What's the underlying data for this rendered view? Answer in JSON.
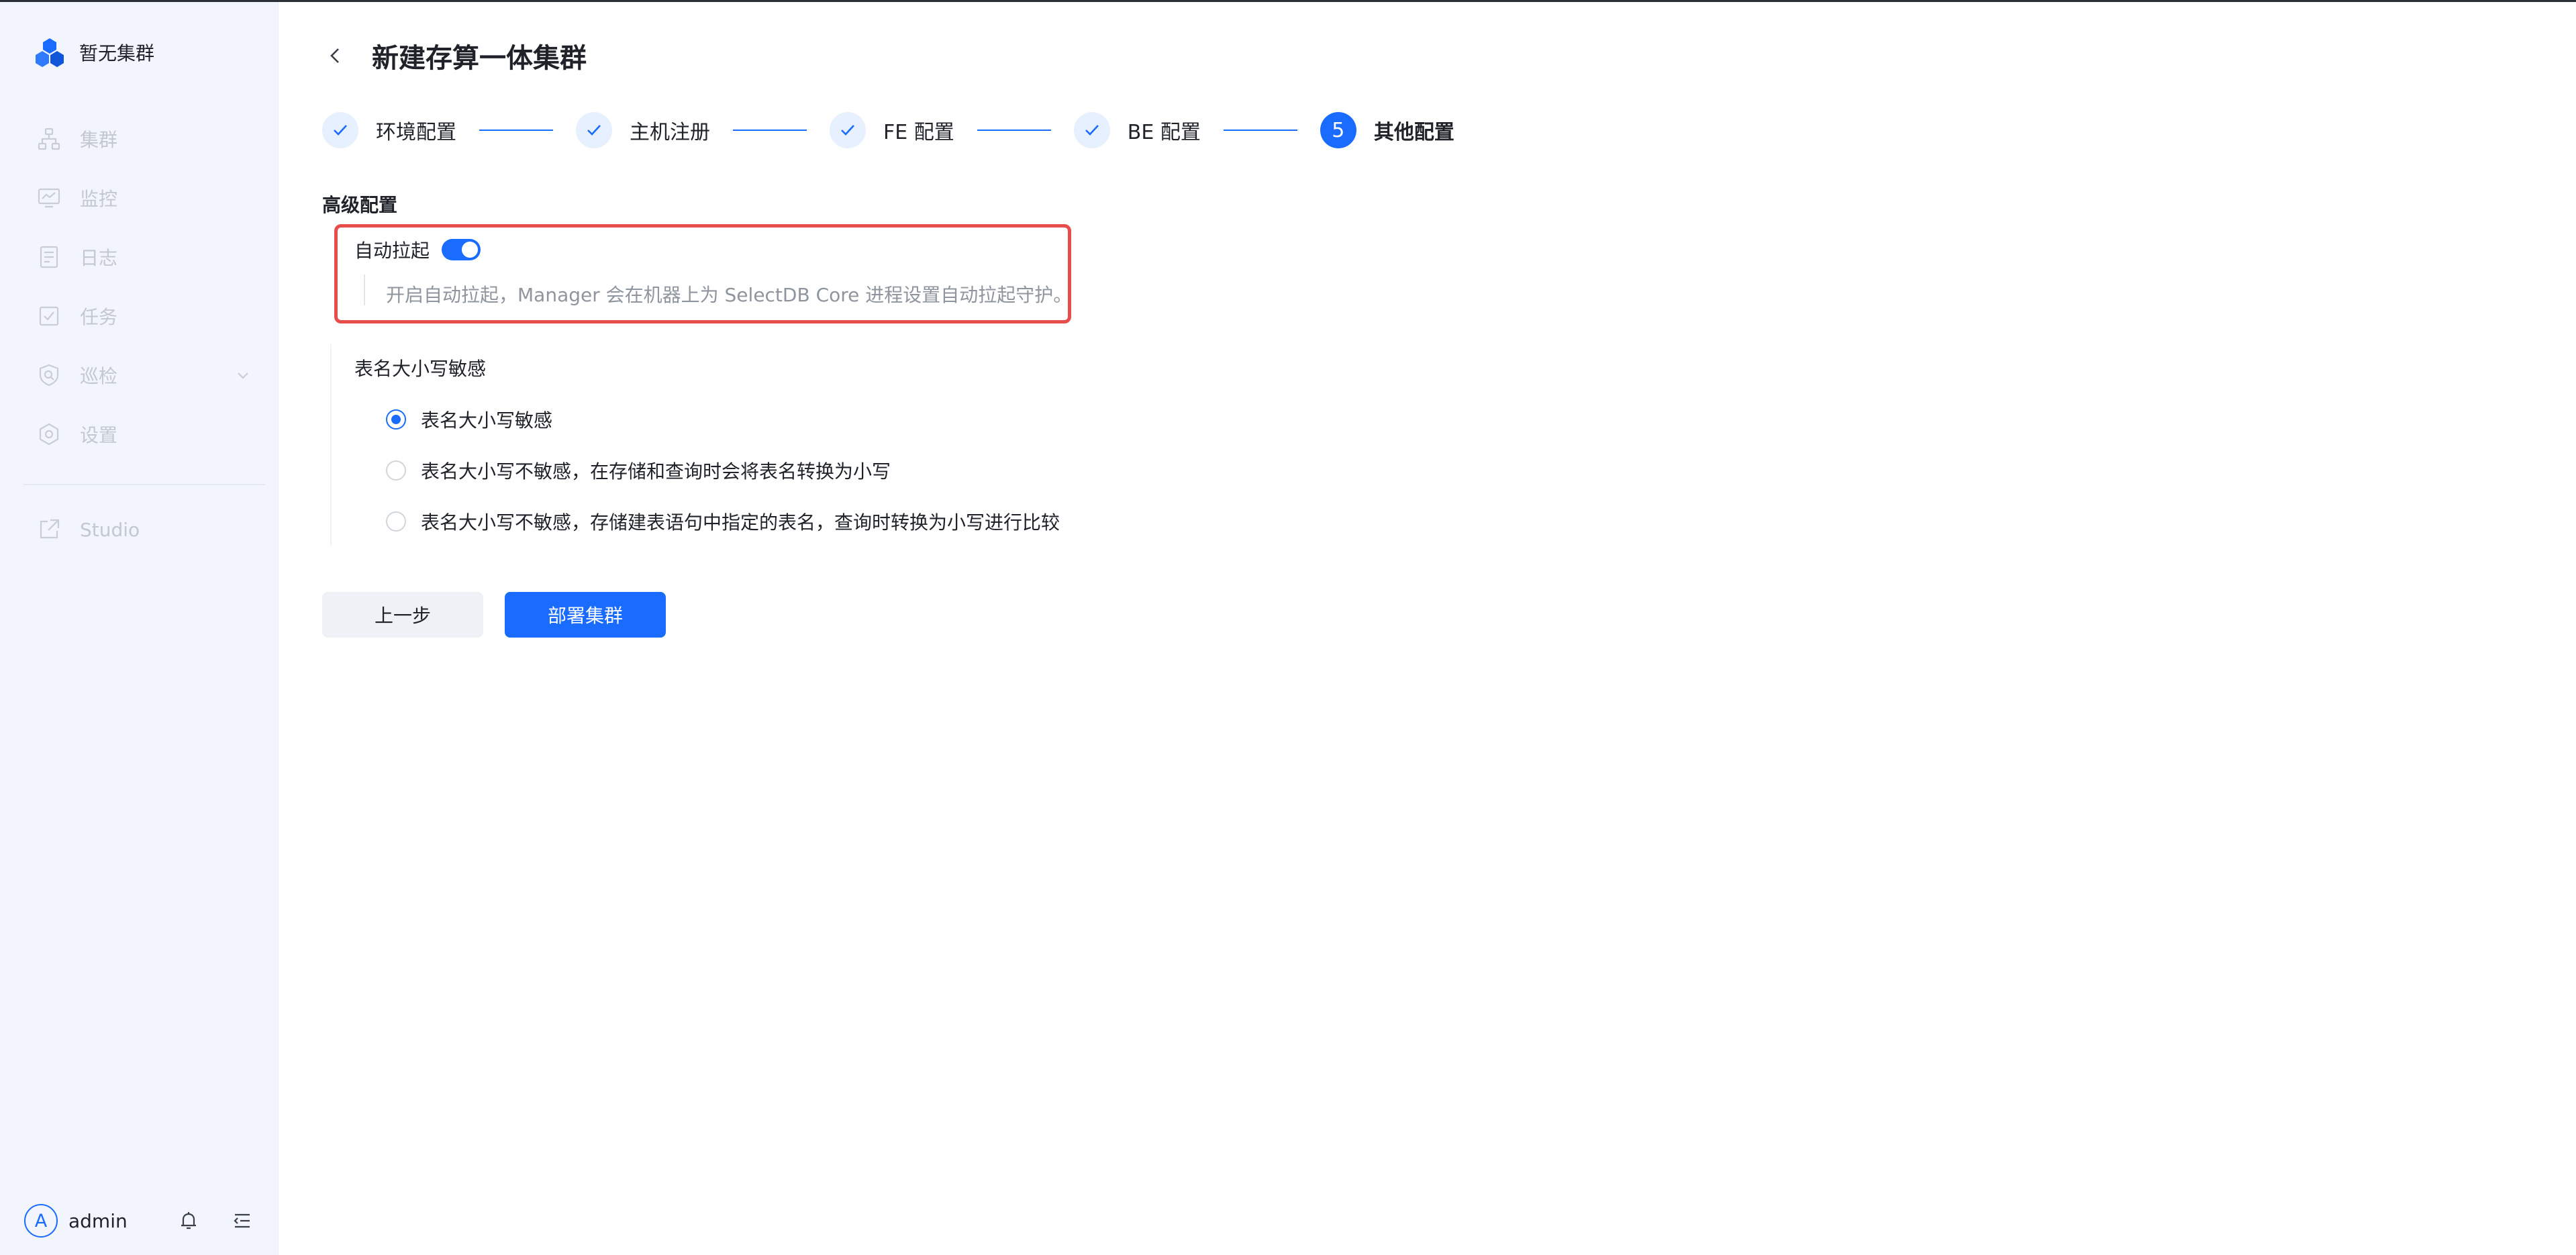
{
  "sidebar": {
    "brand_label": "暂无集群",
    "items": [
      {
        "label": "集群",
        "icon": "cluster-icon"
      },
      {
        "label": "监控",
        "icon": "monitor-icon"
      },
      {
        "label": "日志",
        "icon": "log-icon"
      },
      {
        "label": "任务",
        "icon": "task-icon"
      },
      {
        "label": "巡检",
        "icon": "inspection-icon"
      },
      {
        "label": "设置",
        "icon": "settings-icon"
      }
    ],
    "studio_label": "Studio",
    "user": {
      "avatar_letter": "A",
      "name": "admin"
    }
  },
  "header": {
    "title": "新建存算一体集群"
  },
  "steps": [
    {
      "label": "环境配置",
      "status": "done"
    },
    {
      "label": "主机注册",
      "status": "done"
    },
    {
      "label": "FE 配置",
      "status": "done"
    },
    {
      "label": "BE 配置",
      "status": "done"
    },
    {
      "label": "其他配置",
      "status": "active",
      "number": "5"
    }
  ],
  "advanced": {
    "title": "高级配置",
    "auto_restart": {
      "label": "自动拉起",
      "enabled": true,
      "help": "开启自动拉起，Manager 会在机器上为 SelectDB Core 进程设置自动拉起守护。"
    },
    "case_sensitivity": {
      "label": "表名大小写敏感",
      "options": [
        {
          "label": "表名大小写敏感",
          "checked": true
        },
        {
          "label": "表名大小写不敏感，在存储和查询时会将表名转换为小写",
          "checked": false
        },
        {
          "label": "表名大小写不敏感，存储建表语句中指定的表名，查询时转换为小写进行比较",
          "checked": false
        }
      ]
    }
  },
  "actions": {
    "prev_label": "上一步",
    "deploy_label": "部署集群"
  },
  "colors": {
    "primary": "#1a6bff",
    "highlight": "#e84c4c",
    "sidebar_bg": "#f2f5fb"
  }
}
